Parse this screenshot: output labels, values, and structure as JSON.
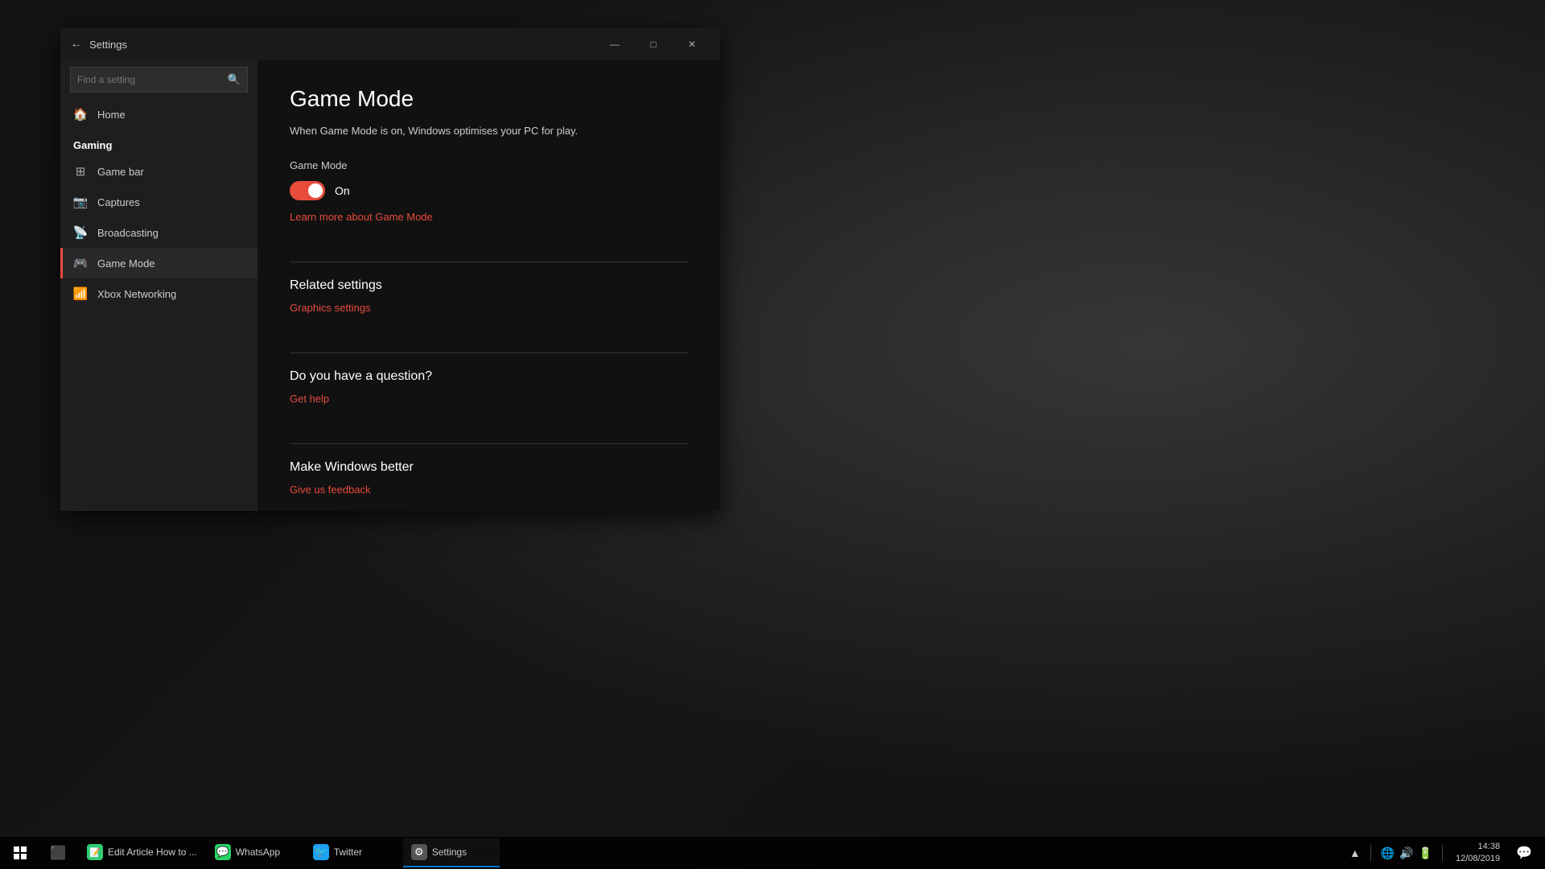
{
  "desktop": {
    "background_desc": "dark fallout themed"
  },
  "titlebar": {
    "title": "Settings",
    "back_label": "←",
    "minimize_label": "—",
    "maximize_label": "□",
    "close_label": "✕"
  },
  "sidebar": {
    "search_placeholder": "Find a setting",
    "home_label": "Home",
    "section_label": "Gaming",
    "items": [
      {
        "id": "game-bar",
        "label": "Game bar",
        "icon": "🎮"
      },
      {
        "id": "captures",
        "label": "Captures",
        "icon": "📷"
      },
      {
        "id": "broadcasting",
        "label": "Broadcasting",
        "icon": "📡"
      },
      {
        "id": "game-mode",
        "label": "Game Mode",
        "icon": "🎮",
        "active": true
      },
      {
        "id": "xbox-networking",
        "label": "Xbox Networking",
        "icon": "📶"
      }
    ]
  },
  "main": {
    "title": "Game Mode",
    "description": "When Game Mode is on, Windows optimises your PC for play.",
    "setting_label": "Game Mode",
    "toggle_state": "On",
    "learn_more_link": "Learn more about Game Mode",
    "related_settings_heading": "Related settings",
    "graphics_settings_link": "Graphics settings",
    "question_heading": "Do you have a question?",
    "get_help_link": "Get help",
    "make_better_heading": "Make Windows better",
    "feedback_link": "Give us feedback"
  },
  "taskbar": {
    "time": "14:38",
    "date": "12/08/2019",
    "apps": [
      {
        "id": "edit-article",
        "label": "Edit Article How to ...",
        "icon": "📝",
        "active": false,
        "color": "#2ecc71"
      },
      {
        "id": "whatsapp",
        "label": "WhatsApp",
        "icon": "💬",
        "active": false,
        "color": "#25d366"
      },
      {
        "id": "twitter",
        "label": "Twitter",
        "icon": "🐦",
        "active": false,
        "color": "#1da1f2"
      },
      {
        "id": "settings",
        "label": "Settings",
        "icon": "⚙",
        "active": true,
        "color": "#888"
      }
    ],
    "system_icons": [
      "🔋",
      "🔊",
      "📶"
    ]
  }
}
